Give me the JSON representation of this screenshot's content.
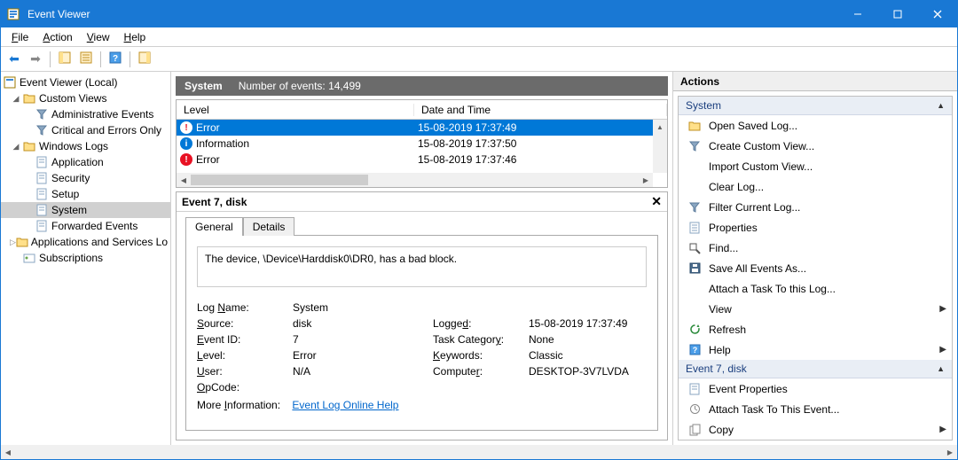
{
  "titlebar": {
    "title": "Event Viewer"
  },
  "menubar": {
    "items": [
      "File",
      "Action",
      "View",
      "Help"
    ]
  },
  "tree": {
    "root": "Event Viewer (Local)",
    "custom_views": "Custom Views",
    "admin_events": "Administrative Events",
    "crit_errors": "Critical and Errors Only",
    "windows_logs": "Windows Logs",
    "application": "Application",
    "security": "Security",
    "setup": "Setup",
    "system": "System",
    "forwarded": "Forwarded Events",
    "apps_services": "Applications and Services Lo",
    "subscriptions": "Subscriptions"
  },
  "center": {
    "title": "System",
    "count_label": "Number of events: 14,499",
    "col_level": "Level",
    "col_date": "Date and Time",
    "rows": [
      {
        "level": "Error",
        "date": "15-08-2019 17:37:49",
        "kind": "error",
        "selected": true
      },
      {
        "level": "Information",
        "date": "15-08-2019 17:37:50",
        "kind": "info",
        "selected": false
      },
      {
        "level": "Error",
        "date": "15-08-2019 17:37:46",
        "kind": "error",
        "selected": false
      }
    ]
  },
  "detail": {
    "header": "Event 7, disk",
    "tab_general": "General",
    "tab_details": "Details",
    "message": "The device, \\Device\\Harddisk0\\DR0, has a bad block.",
    "log_name_l": "Log Name:",
    "log_name_v": "System",
    "source_l": "Source:",
    "source_v": "disk",
    "logged_l": "Logged:",
    "logged_v": "15-08-2019 17:37:49",
    "eventid_l": "Event ID:",
    "eventid_v": "7",
    "taskcat_l": "Task Category:",
    "taskcat_v": "None",
    "level_l": "Level:",
    "level_v": "Error",
    "keywords_l": "Keywords:",
    "keywords_v": "Classic",
    "user_l": "User:",
    "user_v": "N/A",
    "computer_l": "Computer:",
    "computer_v": "DESKTOP-3V7LVDA",
    "opcode_l": "OpCode:",
    "moreinfo_l": "More Information:",
    "moreinfo_link": "Event Log Online Help"
  },
  "actions": {
    "title": "Actions",
    "section1": "System",
    "open_saved": "Open Saved Log...",
    "create_view": "Create Custom View...",
    "import_view": "Import Custom View...",
    "clear_log": "Clear Log...",
    "filter_log": "Filter Current Log...",
    "properties": "Properties",
    "find": "Find...",
    "save_all": "Save All Events As...",
    "attach_task": "Attach a Task To this Log...",
    "view": "View",
    "refresh": "Refresh",
    "help": "Help",
    "section2": "Event 7, disk",
    "event_props": "Event Properties",
    "attach_event": "Attach Task To This Event...",
    "copy": "Copy"
  }
}
